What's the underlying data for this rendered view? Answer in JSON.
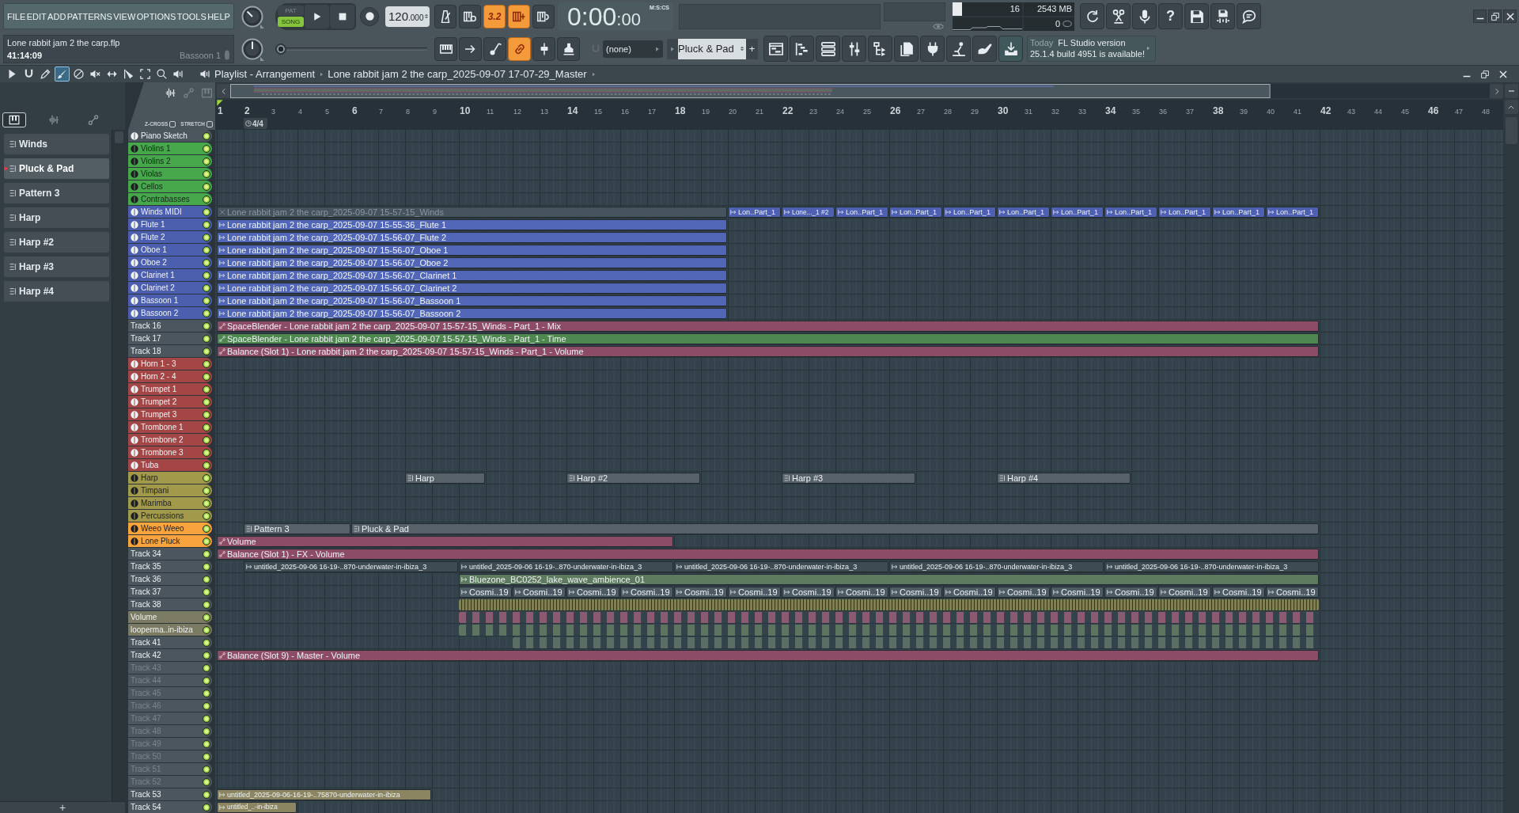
{
  "menu": [
    "FILE",
    "EDIT",
    "ADD",
    "PATTERNS",
    "VIEW",
    "OPTIONS",
    "TOOLS",
    "HELP"
  ],
  "transport": {
    "modes": [
      {
        "label": "PAT",
        "selected": false
      },
      {
        "label": "SONG",
        "selected": true
      }
    ],
    "tempo": "120",
    "tempo_decimals": ".000"
  },
  "toggles": [
    {
      "on": false
    },
    {
      "on": false
    },
    {
      "label": "3.2",
      "on": true
    },
    {
      "on": true
    },
    {
      "on": false
    }
  ],
  "time": {
    "value": "0:00",
    "centiseconds": ":00",
    "format": "M:S:CS"
  },
  "performance": {
    "cpu": {
      "level": 0.14,
      "reading": "16"
    },
    "memory": "2543 MB",
    "count": "0"
  },
  "help": "?",
  "song": {
    "file": "Lone rabbit jam 2 the carp.flp",
    "time": "41:14:09",
    "channel": "Bassoon 1"
  },
  "pitch_slider": {
    "level": 0
  },
  "tools": [
    {
      "on": false
    },
    {
      "on": false
    },
    {
      "on": false
    },
    {
      "on": true
    },
    {
      "on": false
    },
    {
      "on": false
    }
  ],
  "snap": "(none)",
  "pattern": {
    "name": "Pluck & Pad",
    "add": "+"
  },
  "notice": {
    "day": "Today",
    "title": "FL Studio version",
    "body": "25.1.4 build 4951 is available!"
  },
  "playlist": {
    "tools": [
      {
        "selected": false
      },
      {
        "selected": false
      },
      {
        "selected": false
      },
      {
        "selected": true
      },
      {
        "selected": false
      },
      {
        "selected": false
      },
      {
        "selected": false
      },
      {
        "selected": false
      },
      {
        "selected": false
      },
      {
        "selected": false
      },
      {
        "selected": false
      }
    ],
    "title": "Playlist - Arrangement",
    "arrangement": "Lone rabbit jam 2 the carp_2025-09-07 17-07-29_Master",
    "z_cross": {
      "label": "Z-CROSS",
      "checked": false
    },
    "stretch": {
      "label": "STRETCH",
      "checked": false
    },
    "bars": [
      "1",
      "2",
      "3",
      "4",
      "5",
      "6",
      "7",
      "8",
      "9",
      "10",
      "11",
      "12",
      "13",
      "14",
      "15",
      "16",
      "17",
      "18",
      "19",
      "20",
      "21",
      "22",
      "23",
      "24",
      "25",
      "26",
      "27",
      "28",
      "29",
      "30",
      "31",
      "32",
      "33",
      "34",
      "35",
      "36",
      "37",
      "38",
      "39",
      "40",
      "41",
      "42",
      "43",
      "44",
      "45",
      "46",
      "47",
      "48"
    ],
    "time_signature": "4/4"
  },
  "picker": {
    "tabs": [
      {
        "selected": true
      },
      {
        "selected": false
      },
      {
        "selected": false
      }
    ],
    "items": [
      {
        "label": "Winds",
        "selected": false
      },
      {
        "label": "Pluck & Pad",
        "selected": true
      },
      {
        "label": "Pattern 3",
        "selected": false
      },
      {
        "label": "Harp",
        "selected": false
      },
      {
        "label": "Harp #2",
        "selected": false
      },
      {
        "label": "Harp #3",
        "selected": false
      },
      {
        "label": "Harp #4",
        "selected": false
      }
    ],
    "add": "+"
  },
  "tracks": [
    {
      "name": "Piano Sketch",
      "color": "#4b565e",
      "kind": "instrument",
      "dimmed": false,
      "enabled": true
    },
    {
      "name": "Violins 1",
      "color": "#46a84a",
      "kind": "instrument",
      "dimmed": false,
      "enabled": true
    },
    {
      "name": "Violins 2",
      "color": "#46a84a",
      "kind": "instrument",
      "dimmed": false,
      "enabled": true
    },
    {
      "name": "Violas",
      "color": "#46a84a",
      "kind": "instrument",
      "dimmed": false,
      "enabled": true
    },
    {
      "name": "Cellos",
      "color": "#46a84a",
      "kind": "instrument",
      "dimmed": false,
      "enabled": true
    },
    {
      "name": "Contrabasses",
      "color": "#46a84a",
      "kind": "instrument",
      "dimmed": false,
      "enabled": true
    },
    {
      "name": "Winds MIDI",
      "color": "#4c5fae",
      "kind": "instrument",
      "dimmed": false,
      "enabled": true,
      "clips": [
        {
          "kind": "audio",
          "label": "Lone rabbit jam 2 the carp_2025-09-07 15-57-15_Winds",
          "color": "#44535c",
          "muted": true
        },
        {
          "kind": "audio",
          "label": "Lon..Part_1",
          "color": "#4d60b2",
          "muted": false
        },
        {
          "kind": "audio",
          "label": "Lone..._1 #2",
          "color": "#4d60b2",
          "muted": false
        },
        {
          "kind": "audio",
          "label": "Lon..Part_1",
          "color": "#4d60b2",
          "muted": false
        },
        {
          "kind": "audio",
          "label": "Lon..Part_1",
          "color": "#4d60b2",
          "muted": false
        },
        {
          "kind": "audio",
          "label": "Lon..Part_1",
          "color": "#4d60b2",
          "muted": false
        },
        {
          "kind": "audio",
          "label": "Lon..Part_1",
          "color": "#4d60b2",
          "muted": false
        },
        {
          "kind": "audio",
          "label": "Lon..Part_1",
          "color": "#4d60b2",
          "muted": false
        },
        {
          "kind": "audio",
          "label": "Lon..Part_1",
          "color": "#4d60b2",
          "muted": false
        },
        {
          "kind": "audio",
          "label": "Lon..Part_1",
          "color": "#4d60b2",
          "muted": false
        },
        {
          "kind": "audio",
          "label": "Lon..Part_1",
          "color": "#4d60b2",
          "muted": false
        },
        {
          "kind": "audio",
          "label": "Lon..Part_1",
          "color": "#4d60b2",
          "muted": false
        }
      ]
    },
    {
      "name": "Flute 1",
      "color": "#4c5fae",
      "kind": "instrument",
      "dimmed": false,
      "enabled": true,
      "clips": [
        {
          "kind": "audio",
          "label": "Lone rabbit jam 2 the carp_2025-09-07 15-55-36_Flute 1",
          "color": "#5166b6",
          "muted": false
        }
      ]
    },
    {
      "name": "Flute 2",
      "color": "#4c5fae",
      "kind": "instrument",
      "dimmed": false,
      "enabled": true,
      "clips": [
        {
          "kind": "audio",
          "label": "Lone rabbit jam 2 the carp_2025-09-07 15-56-07_Flute 2",
          "color": "#5166b6",
          "muted": false
        }
      ]
    },
    {
      "name": "Oboe 1",
      "color": "#4c5fae",
      "kind": "instrument",
      "dimmed": false,
      "enabled": true,
      "clips": [
        {
          "kind": "audio",
          "label": "Lone rabbit jam 2 the carp_2025-09-07 15-56-07_Oboe 1",
          "color": "#5166b6",
          "muted": false
        }
      ]
    },
    {
      "name": "Oboe 2",
      "color": "#4c5fae",
      "kind": "instrument",
      "dimmed": false,
      "enabled": true,
      "clips": [
        {
          "kind": "audio",
          "label": "Lone rabbit jam 2 the carp_2025-09-07 15-56-07_Oboe 2",
          "color": "#5166b6",
          "muted": false
        }
      ]
    },
    {
      "name": "Clarinet 1",
      "color": "#4c5fae",
      "kind": "instrument",
      "dimmed": false,
      "enabled": true,
      "clips": [
        {
          "kind": "audio",
          "label": "Lone rabbit jam 2 the carp_2025-09-07 15-56-07_Clarinet 1",
          "color": "#5166b6",
          "muted": false
        }
      ]
    },
    {
      "name": "Clarinet 2",
      "color": "#4c5fae",
      "kind": "instrument",
      "dimmed": false,
      "enabled": true,
      "clips": [
        {
          "kind": "audio",
          "label": "Lone rabbit jam 2 the carp_2025-09-07 15-56-07_Clarinet 2",
          "color": "#5166b6",
          "muted": false
        }
      ]
    },
    {
      "name": "Bassoon 1",
      "color": "#4c5fae",
      "kind": "instrument",
      "dimmed": false,
      "enabled": true,
      "clips": [
        {
          "kind": "audio",
          "label": "Lone rabbit jam 2 the carp_2025-09-07 15-56-07_Bassoon 1",
          "color": "#5166b6",
          "muted": false
        }
      ]
    },
    {
      "name": "Bassoon 2",
      "color": "#4c5fae",
      "kind": "instrument",
      "dimmed": false,
      "enabled": true,
      "clips": [
        {
          "kind": "audio",
          "label": "Lone rabbit jam 2 the carp_2025-09-07 15-56-07_Bassoon 2",
          "color": "#5166b6",
          "muted": false
        }
      ]
    },
    {
      "name": "Track 16",
      "color": "#4b565e",
      "kind": "plain",
      "dimmed": false,
      "enabled": true,
      "clips": [
        {
          "kind": "automation",
          "label": "SpaceBlender - Lone rabbit jam 2 the carp_2025-09-07 15-57-15_Winds - Part_1 - Mix",
          "color": "#8d4c66",
          "muted": false
        }
      ]
    },
    {
      "name": "Track 17",
      "color": "#4b565e",
      "kind": "plain",
      "dimmed": false,
      "enabled": true,
      "clips": [
        {
          "kind": "automation",
          "label": "SpaceBlender - Lone rabbit jam 2 the carp_2025-09-07 15-57-15_Winds - Part_1 - Time",
          "color": "#4f8750",
          "muted": false
        }
      ]
    },
    {
      "name": "Track 18",
      "color": "#4b565e",
      "kind": "plain",
      "dimmed": false,
      "enabled": true,
      "clips": [
        {
          "kind": "automation",
          "label": "Balance (Slot 1) - Lone rabbit jam 2 the carp_2025-09-07 15-57-15_Winds - Part_1 - Volume",
          "color": "#8d4c66",
          "muted": false
        }
      ]
    },
    {
      "name": "Horn 1 - 3",
      "color": "#a44646",
      "kind": "instrument",
      "dimmed": false,
      "enabled": true
    },
    {
      "name": "Horn 2 - 4",
      "color": "#a44646",
      "kind": "instrument",
      "dimmed": false,
      "enabled": true
    },
    {
      "name": "Trumpet 1",
      "color": "#a44646",
      "kind": "instrument",
      "dimmed": false,
      "enabled": true
    },
    {
      "name": "Trumpet 2",
      "color": "#a44646",
      "kind": "instrument",
      "dimmed": false,
      "enabled": true
    },
    {
      "name": "Trumpet 3",
      "color": "#a44646",
      "kind": "instrument",
      "dimmed": false,
      "enabled": true
    },
    {
      "name": "Trombone 1",
      "color": "#a44646",
      "kind": "instrument",
      "dimmed": false,
      "enabled": true
    },
    {
      "name": "Trombone 2",
      "color": "#a44646",
      "kind": "instrument",
      "dimmed": false,
      "enabled": true
    },
    {
      "name": "Trombone 3",
      "color": "#a44646",
      "kind": "instrument",
      "dimmed": false,
      "enabled": true
    },
    {
      "name": "Tuba",
      "color": "#a44646",
      "kind": "instrument",
      "dimmed": false,
      "enabled": true
    },
    {
      "name": "Harp",
      "color": "#a29a4a",
      "kind": "instrument",
      "dimmed": false,
      "enabled": true,
      "clips": [
        {
          "kind": "pattern",
          "label": "Harp",
          "color": "#56616a",
          "muted": false
        },
        {
          "kind": "pattern",
          "label": "Harp #2",
          "color": "#56616a",
          "muted": false
        },
        {
          "kind": "pattern",
          "label": "Harp #3",
          "color": "#56616a",
          "muted": false
        },
        {
          "kind": "pattern",
          "label": "Harp #4",
          "color": "#56616a",
          "muted": false
        }
      ]
    },
    {
      "name": "Timpani",
      "color": "#a29a4a",
      "kind": "instrument",
      "dimmed": false,
      "enabled": true
    },
    {
      "name": "Marimba",
      "color": "#a29a4a",
      "kind": "instrument",
      "dimmed": false,
      "enabled": true
    },
    {
      "name": "Percussions",
      "color": "#a29a4a",
      "kind": "instrument",
      "dimmed": false,
      "enabled": true
    },
    {
      "name": "Weeo Weeo",
      "color": "#f9a33f",
      "kind": "instrument",
      "dimmed": false,
      "enabled": true,
      "clips": [
        {
          "kind": "pattern",
          "label": "Pattern 3",
          "color": "#56616a",
          "muted": false
        },
        {
          "kind": "pattern",
          "label": "Pluck & Pad",
          "color": "#56616a",
          "muted": false
        }
      ]
    },
    {
      "name": "Lone Pluck",
      "color": "#f9a33f",
      "kind": "instrument",
      "dimmed": false,
      "enabled": true,
      "clips": [
        {
          "kind": "automation",
          "label": "Volume",
          "color": "#8d4c66",
          "muted": false
        }
      ]
    },
    {
      "name": "Track 34",
      "color": "#4b565e",
      "kind": "plain",
      "dimmed": false,
      "enabled": true,
      "clips": [
        {
          "kind": "automation",
          "label": "Balance (Slot 1) - FX - Volume",
          "color": "#8d4c66",
          "muted": false
        }
      ]
    },
    {
      "name": "Track 35",
      "color": "#4b565e",
      "kind": "plain",
      "dimmed": false,
      "enabled": true,
      "clips": [
        {
          "kind": "audio",
          "label": "untitled_2025-09-06 16-19-..870-underwater-in-ibiza_3",
          "color": "#3d4b53",
          "muted": false
        },
        {
          "kind": "audio",
          "label": "untitled_2025-09-06 16-19-..870-underwater-in-ibiza_3",
          "color": "#3d4b53",
          "muted": false
        },
        {
          "kind": "audio",
          "label": "untitled_2025-09-06 16-19-..870-underwater-in-ibiza_3",
          "color": "#3d4b53",
          "muted": false
        },
        {
          "kind": "audio",
          "label": "untitled_2025-09-06 16-19-..870-underwater-in-ibiza_3",
          "color": "#3d4b53",
          "muted": false
        },
        {
          "kind": "audio",
          "label": "untitled_2025-09-06 16-19-..870-underwater-in-ibiza_3",
          "color": "#3d4b53",
          "muted": false
        }
      ]
    },
    {
      "name": "Track 36",
      "color": "#4b565e",
      "kind": "plain",
      "dimmed": false,
      "enabled": true,
      "clips": [
        {
          "kind": "audio",
          "label": "Bluezone_BC0252_lake_wave_ambience_01",
          "color": "#5d7a5e",
          "muted": false
        }
      ]
    },
    {
      "name": "Track 37",
      "color": "#4b565e",
      "kind": "plain",
      "dimmed": false,
      "enabled": true,
      "clips": [
        {
          "kind": "audio",
          "label": "Cosmi..19",
          "color": "#4d5b65",
          "muted": false
        },
        {
          "kind": "audio",
          "label": "Cosmi..19",
          "color": "#4d5b65",
          "muted": false
        },
        {
          "kind": "audio",
          "label": "Cosmi..19",
          "color": "#4d5b65",
          "muted": false
        },
        {
          "kind": "audio",
          "label": "Cosmi..19",
          "color": "#4d5b65",
          "muted": false
        },
        {
          "kind": "audio",
          "label": "Cosmi..19",
          "color": "#4d5b65",
          "muted": false
        },
        {
          "kind": "audio",
          "label": "Cosmi..19",
          "color": "#4d5b65",
          "muted": false
        },
        {
          "kind": "audio",
          "label": "Cosmi..19",
          "color": "#4d5b65",
          "muted": false
        },
        {
          "kind": "audio",
          "label": "Cosmi..19",
          "color": "#4d5b65",
          "muted": false
        },
        {
          "kind": "audio",
          "label": "Cosmi..19",
          "color": "#4d5b65",
          "muted": false
        },
        {
          "kind": "audio",
          "label": "Cosmi..19",
          "color": "#4d5b65",
          "muted": false
        },
        {
          "kind": "audio",
          "label": "Cosmi..19",
          "color": "#4d5b65",
          "muted": false
        },
        {
          "kind": "audio",
          "label": "Cosmi..19",
          "color": "#4d5b65",
          "muted": false
        },
        {
          "kind": "audio",
          "label": "Cosmi..19",
          "color": "#4d5b65",
          "muted": false
        },
        {
          "kind": "audio",
          "label": "Cosmi..19",
          "color": "#4d5b65",
          "muted": false
        },
        {
          "kind": "audio",
          "label": "Cosmi..19",
          "color": "#4d5b65",
          "muted": false
        },
        {
          "kind": "audio",
          "label": "Cosmi..19",
          "color": "#4d5b65",
          "muted": false
        }
      ]
    },
    {
      "name": "Track 38",
      "color": "#4b565e",
      "kind": "plain",
      "dimmed": false,
      "enabled": true,
      "clips": [
        {
          "kind": "dense",
          "color": "#7f8055",
          "muted": false
        }
      ]
    },
    {
      "name": "Volume",
      "color": "#7b7a62",
      "kind": "plain",
      "dimmed": false,
      "enabled": true,
      "clips": [
        {
          "kind": "sparse",
          "color": "#8a5a70",
          "muted": false
        }
      ]
    },
    {
      "name": "looperma..in-ibiza",
      "color": "#7b7a62",
      "kind": "plain",
      "dimmed": false,
      "enabled": true,
      "clips": [
        {
          "kind": "sparse",
          "color": "#5d7560",
          "muted": false
        }
      ]
    },
    {
      "name": "Track 41",
      "color": "#4b565e",
      "kind": "plain",
      "dimmed": false,
      "enabled": true,
      "clips": [
        {
          "kind": "sparse",
          "color": "#5b6e66",
          "muted": false
        }
      ]
    },
    {
      "name": "Track 42",
      "color": "#4b565e",
      "kind": "plain",
      "dimmed": false,
      "enabled": true,
      "clips": [
        {
          "kind": "automation",
          "label": "Balance (Slot 9) - Master - Volume",
          "color": "#8d4c66",
          "muted": false
        }
      ]
    },
    {
      "name": "Track 43",
      "color": "#4b565e",
      "kind": "plain",
      "dimmed": true,
      "enabled": true
    },
    {
      "name": "Track 44",
      "color": "#4b565e",
      "kind": "plain",
      "dimmed": true,
      "enabled": true
    },
    {
      "name": "Track 45",
      "color": "#4b565e",
      "kind": "plain",
      "dimmed": true,
      "enabled": true
    },
    {
      "name": "Track 46",
      "color": "#4b565e",
      "kind": "plain",
      "dimmed": true,
      "enabled": true
    },
    {
      "name": "Track 47",
      "color": "#4b565e",
      "kind": "plain",
      "dimmed": true,
      "enabled": true
    },
    {
      "name": "Track 48",
      "color": "#4b565e",
      "kind": "plain",
      "dimmed": true,
      "enabled": true
    },
    {
      "name": "Track 49",
      "color": "#4b565e",
      "kind": "plain",
      "dimmed": true,
      "enabled": true
    },
    {
      "name": "Track 50",
      "color": "#4b565e",
      "kind": "plain",
      "dimmed": true,
      "enabled": true
    },
    {
      "name": "Track 51",
      "color": "#4b565e",
      "kind": "plain",
      "dimmed": true,
      "enabled": true
    },
    {
      "name": "Track 52",
      "color": "#4b565e",
      "kind": "plain",
      "dimmed": true,
      "enabled": true
    },
    {
      "name": "Track 53",
      "color": "#4b565e",
      "kind": "plain",
      "dimmed": false,
      "enabled": true,
      "clips": [
        {
          "kind": "audio",
          "label": "untitled_2025-09-06-16-19-..75870-underwater-in-ibiza",
          "color": "#8b8561",
          "muted": false
        }
      ]
    },
    {
      "name": "Track 54",
      "color": "#4b565e",
      "kind": "plain",
      "dimmed": false,
      "enabled": true,
      "clips": [
        {
          "kind": "audio",
          "label": "untitled_..-in-ibiza",
          "color": "#8b8561",
          "muted": false
        }
      ]
    }
  ]
}
